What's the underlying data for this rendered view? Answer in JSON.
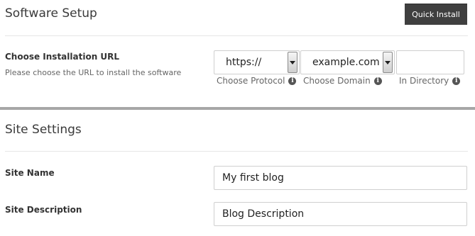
{
  "software_setup": {
    "title": "Software Setup",
    "quick_install_label": "Quick Install",
    "install_url": {
      "label": "Choose Installation URL",
      "description": "Please choose the URL to install the software",
      "protocol": {
        "value": "https://",
        "caption": "Choose Protocol"
      },
      "domain": {
        "value": "example.com",
        "caption": "Choose Domain"
      },
      "directory": {
        "value": "",
        "caption": "In Directory"
      }
    }
  },
  "site_settings": {
    "title": "Site Settings",
    "site_name": {
      "label": "Site Name",
      "value": "My first blog"
    },
    "site_description": {
      "label": "Site Description",
      "value": "Blog Description"
    }
  },
  "icons": {
    "info": "info-icon",
    "dropdown": "chevron-down-icon"
  }
}
